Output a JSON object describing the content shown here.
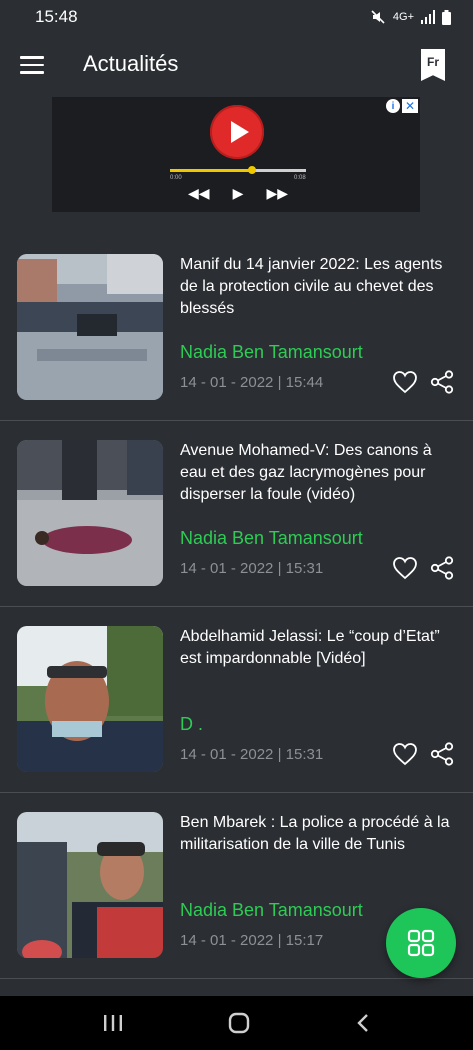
{
  "status_bar": {
    "time": "15:48",
    "network": "4G+"
  },
  "app_bar": {
    "title": "Actualités",
    "language": "Fr"
  },
  "ad": {
    "info": "i",
    "close": "✕",
    "time_start": "0:00",
    "time_end": "0:08",
    "progress": 0.6
  },
  "articles": [
    {
      "title": "Manif du 14 janvier 2022: Les agents de la protection civile au chevet des blessés",
      "author": "Nadia Ben Tamansourt",
      "date": "14 - 01 - 2022 | 15:44"
    },
    {
      "title": "Avenue Mohamed-V: Des canons à eau et des gaz lacrymogènes  pour disperser la foule (vidéo)",
      "author": "Nadia Ben Tamansourt",
      "date": "14 - 01 - 2022 | 15:31"
    },
    {
      "title": "Abdelhamid Jelassi: Le “coup d’Etat” est impardonnable [Vidéo]",
      "author": "D .",
      "date": "14 - 01 - 2022 | 15:31"
    },
    {
      "title": "Ben Mbarek : La police a procédé à la militarisation de la ville de Tunis",
      "author": "Nadia Ben Tamansourt",
      "date": "14 - 01 - 2022 | 15:17"
    }
  ],
  "colors": {
    "background": "#2b2e33",
    "accent": "#2ecc55",
    "fab": "#1ec65a"
  }
}
